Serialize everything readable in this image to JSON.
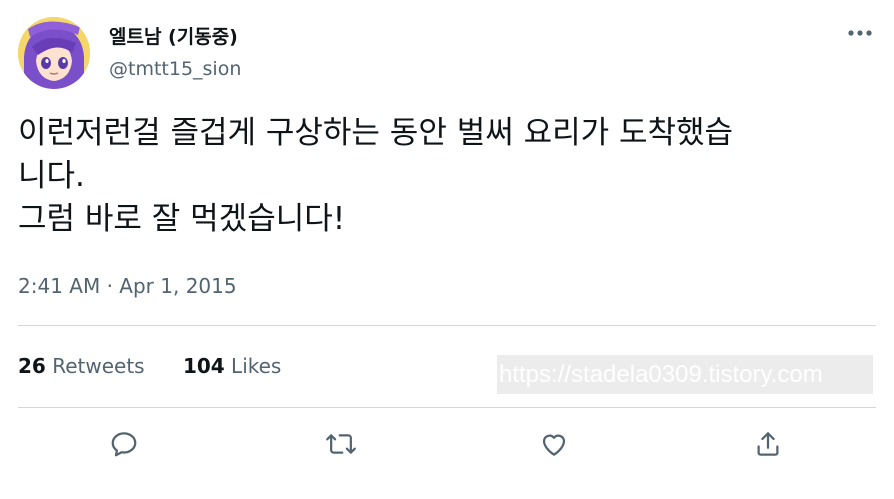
{
  "tweet": {
    "author": {
      "display_name": "엘트남 (기동중)",
      "handle": "@tmtt15_sion"
    },
    "text": "이런저런걸 즐겁게 구상하는 동안 벌써 요리가 도착했습\n니다.\n그럼 바로 잘 먹겠습니다!",
    "time": "2:41 AM",
    "separator": "·",
    "date": "Apr 1, 2015"
  },
  "stats": {
    "retweets_count": "26",
    "retweets_label": "Retweets",
    "likes_count": "104",
    "likes_label": "Likes"
  },
  "watermark": "https://stadela0309.tistory.com",
  "actions": [
    "reply-icon",
    "retweet-icon",
    "like-icon",
    "share-icon"
  ],
  "colors": {
    "text_primary": "#0f1419",
    "text_secondary": "#536471",
    "icon": "#536471",
    "divider": "#cfd9de"
  }
}
